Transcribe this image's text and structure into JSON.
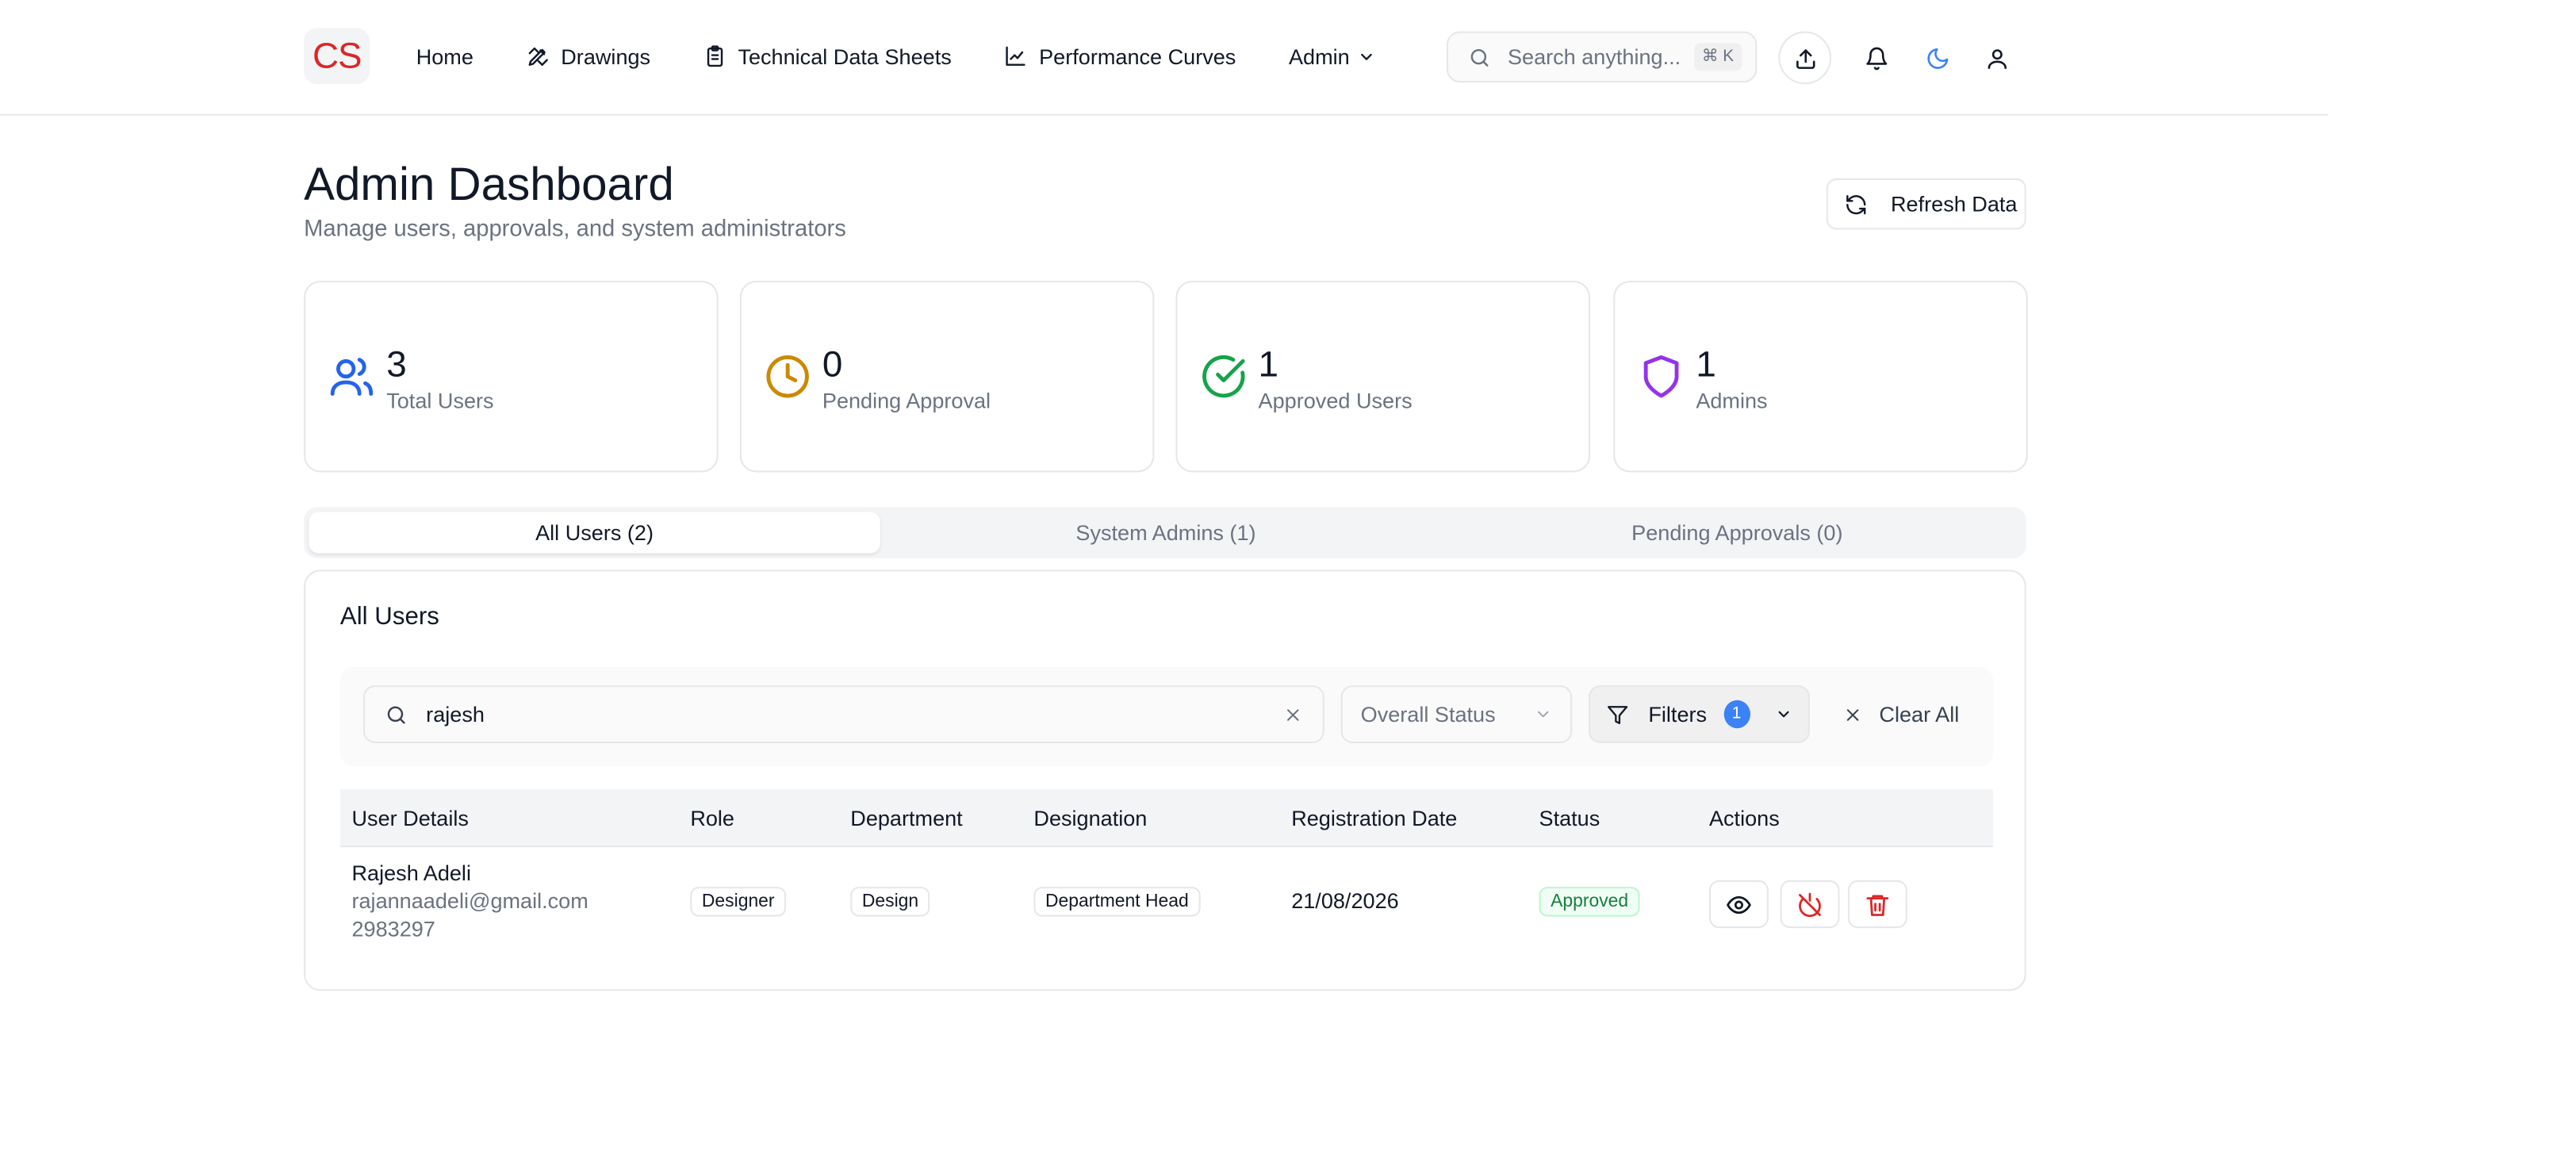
{
  "header": {
    "logo": "CS",
    "nav": [
      {
        "label": "Home"
      },
      {
        "label": "Drawings"
      },
      {
        "label": "Technical Data Sheets"
      },
      {
        "label": "Performance Curves"
      },
      {
        "label": "Admin"
      }
    ],
    "search": {
      "placeholder": "Search anything...",
      "shortcut": "⌘ K"
    }
  },
  "page": {
    "title": "Admin Dashboard",
    "subtitle": "Manage users, approvals, and system administrators",
    "refresh_label": "Refresh Data"
  },
  "stats": [
    {
      "value": "3",
      "label": "Total Users",
      "color": "#2563eb"
    },
    {
      "value": "0",
      "label": "Pending Approval",
      "color": "#ca8a04"
    },
    {
      "value": "1",
      "label": "Approved Users",
      "color": "#16a34a"
    },
    {
      "value": "1",
      "label": "Admins",
      "color": "#9333ea"
    }
  ],
  "tabs": [
    {
      "label": "All Users (2)"
    },
    {
      "label": "System Admins (1)"
    },
    {
      "label": "Pending Approvals (0)"
    }
  ],
  "panel": {
    "title": "All Users",
    "search_value": "rajesh",
    "status_select": "Overall Status",
    "filters_label": "Filters",
    "filters_count": "1",
    "clear_label": "Clear All"
  },
  "table": {
    "columns": [
      "User Details",
      "Role",
      "Department",
      "Designation",
      "Registration Date",
      "Status",
      "Actions"
    ],
    "rows": [
      {
        "name": "Rajesh Adeli",
        "email": "rajannaadeli@gmail.com",
        "phone": "2983297",
        "role": "Designer",
        "department": "Design",
        "designation": "Department Head",
        "date": "21/08/2026",
        "status": "Approved"
      }
    ]
  }
}
